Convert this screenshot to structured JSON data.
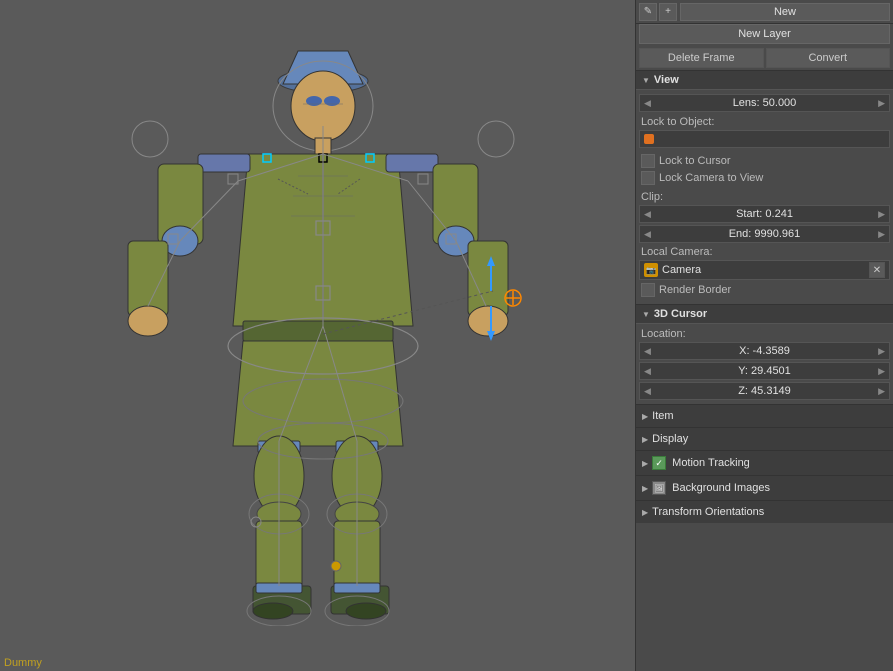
{
  "toolbar": {
    "new_label": "New",
    "new_layer_label": "New Layer",
    "delete_frame_label": "Delete Frame",
    "convert_label": "Convert"
  },
  "view_section": {
    "title": "View",
    "lens_label": "Lens: 50.000",
    "lens_value": "Lens: 50.000",
    "lock_to_object_label": "Lock to Object:",
    "lock_to_cursor_label": "Lock to Cursor",
    "lock_camera_label": "Lock Camera to View",
    "clip_label": "Clip:",
    "clip_start": "Start: 0.241",
    "clip_end": "End: 9990.961",
    "local_camera_label": "Local Camera:",
    "camera_name": "Camera",
    "render_border_label": "Render Border"
  },
  "cursor_section": {
    "title": "3D Cursor",
    "location_label": "Location:",
    "x_value": "X: -4.3589",
    "y_value": "Y: 29.4501",
    "z_value": "Z: 45.3149"
  },
  "item_section": {
    "title": "Item"
  },
  "display_section": {
    "title": "Display"
  },
  "motion_tracking_section": {
    "title": "Motion Tracking"
  },
  "background_images_section": {
    "title": "Background Images"
  },
  "transform_orientations_section": {
    "title": "Transform Orientations"
  },
  "bottom_label": "Dummy"
}
